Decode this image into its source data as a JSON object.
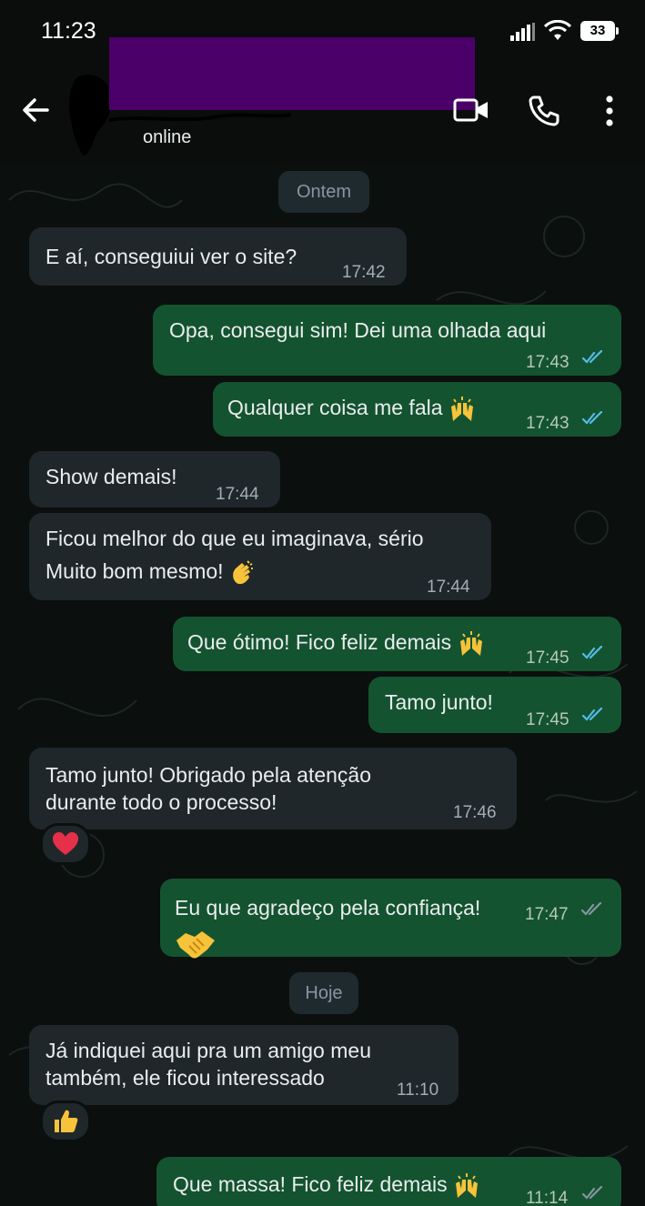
{
  "status_bar": {
    "time": "11:23",
    "battery": "33"
  },
  "header": {
    "contact_status": "online"
  },
  "icons": {
    "back": "arrow-left-icon",
    "video": "video-camera-icon",
    "call": "phone-icon",
    "menu": "more-vertical-icon",
    "read": "double-check-icon",
    "raised_hands": "raised-hands-emoji",
    "clap": "clapping-hands-emoji",
    "handshake": "handshake-emoji",
    "heart": "red-heart-emoji",
    "thumbs": "thumbs-up-emoji"
  },
  "colors": {
    "incoming": "#1f272a",
    "outgoing": "#14532f",
    "read_tick": "#53bdeb",
    "delivered_tick": "#8696a0",
    "redaction": "#4b0069"
  },
  "days": [
    {
      "label": "Ontem"
    },
    {
      "label": "Hoje"
    }
  ],
  "messages": [
    {
      "direction": "in",
      "text": "E aí, conseguiui ver o site?",
      "time": "17:42"
    },
    {
      "direction": "out",
      "text": "Opa, consegui sim! Dei uma olhada aqui",
      "time": "17:43",
      "status": "read"
    },
    {
      "direction": "out",
      "text": "Qualquer coisa me fala",
      "time": "17:43",
      "status": "read",
      "emoji": "raised-hands"
    },
    {
      "direction": "in",
      "text": "Show demais!",
      "time": "17:44"
    },
    {
      "direction": "in",
      "lines": [
        "Ficou melhor do que eu imaginava, sério",
        "Muito bom mesmo!"
      ],
      "time": "17:44",
      "emoji": "clapping-hands"
    },
    {
      "direction": "out",
      "text": "Que ótimo! Fico feliz demais",
      "time": "17:45",
      "status": "read",
      "emoji": "raised-hands"
    },
    {
      "direction": "out",
      "text": "Tamo junto!",
      "time": "17:45",
      "status": "read"
    },
    {
      "direction": "in",
      "lines": [
        "Tamo junto! Obrigado pela atenção",
        "durante todo o processo!"
      ],
      "time": "17:46",
      "reaction": "red-heart"
    },
    {
      "direction": "out",
      "text": "Eu que agradeço pela confiança!",
      "time": "17:47",
      "status": "delivered",
      "emoji": "handshake"
    },
    {
      "direction": "in",
      "lines": [
        "Já indiquei aqui pra um amigo meu",
        "também, ele ficou interessado"
      ],
      "time": "11:10",
      "reaction": "thumbs-up"
    },
    {
      "direction": "out",
      "text": "Que massa! Fico feliz demais",
      "time": "11:14",
      "status": "delivered",
      "emoji": "raised-hands"
    }
  ]
}
